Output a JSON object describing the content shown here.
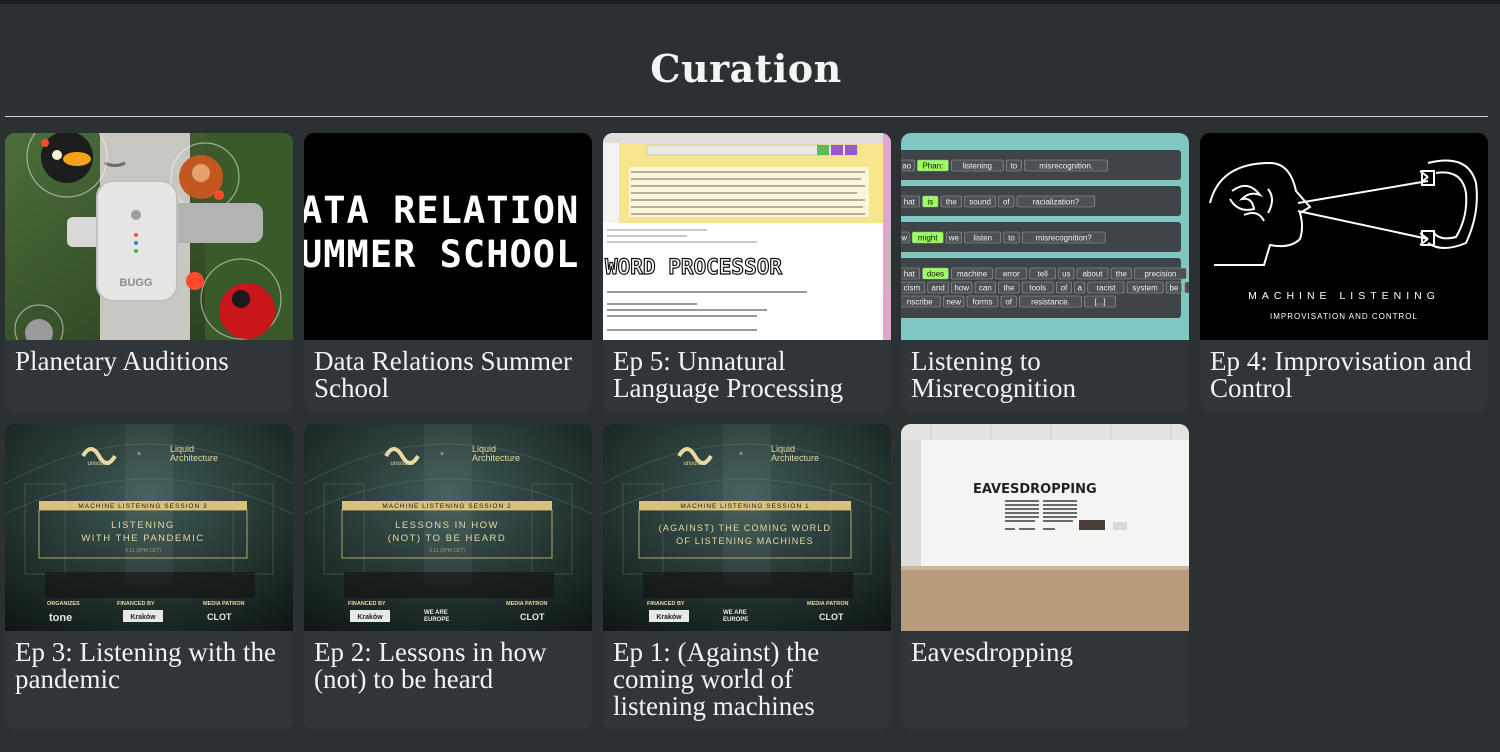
{
  "page": {
    "heading": "Curation"
  },
  "cards": [
    {
      "title": "Planetary Auditions",
      "thumb": {
        "brand": "BUGG"
      }
    },
    {
      "title": "Data Relations Summer School",
      "thumb": {
        "line1": "ATA RELATION",
        "line2": "UMMER SCHOOL"
      }
    },
    {
      "title": "Ep 5: Unnatural Language Processing",
      "thumb": {
        "banner": "WORD PROCESSOR"
      }
    },
    {
      "title": "Listening to Misrecognition",
      "thumb": {
        "rows": [
          [
            "ao",
            "Phan:",
            "listening",
            "to",
            "misrecognition."
          ],
          [
            "hat",
            "is",
            "the",
            "sound",
            "of",
            "racialization?"
          ],
          [
            "w",
            "might",
            "we",
            "listen",
            "to",
            "misrecognition?"
          ],
          [
            "hat",
            "does",
            "machine",
            "error",
            "tell",
            "us",
            "about",
            "the",
            "precision",
            "of"
          ],
          [
            "cism",
            "and",
            "how",
            "can",
            "the",
            "tools",
            "of",
            "a",
            "racist",
            "system",
            "be",
            "used",
            "to"
          ],
          [
            "nscribe",
            "new",
            "forms",
            "of",
            "resistance.",
            "[...]"
          ]
        ]
      }
    },
    {
      "title": "Ep 4: Improvisation and Control",
      "thumb": {
        "line1": "MACHINE LISTENING",
        "line2": "IMPROVISATION AND CONTROL"
      }
    },
    {
      "title": "Ep 3: Listening with the pandemic",
      "thumb": {
        "logo_left": "unsound",
        "logo_right_1": "Liquid",
        "logo_right_2": "Architecture",
        "session": "MACHINE LISTENING SESSION 3",
        "line1": "LISTENING",
        "line2": "WITH THE PANDEMIC",
        "date": "4.11 (3PM CET)",
        "org": "ORGANIZES",
        "fin": "FINANCED BY",
        "media": "MEDIA PATRON",
        "krakow": "Kraków",
        "tone": "tone",
        "clot": "CLOT"
      }
    },
    {
      "title": "Ep 2: Lessons in how (not) to be heard",
      "thumb": {
        "logo_left": "unsound",
        "logo_right_1": "Liquid",
        "logo_right_2": "Architecture",
        "session": "MACHINE LISTENING SESSION 2",
        "line1": "LESSONS IN HOW",
        "line2": "(NOT) TO BE HEARD",
        "date": "3.11 (3PM CET)",
        "fin": "FINANCED BY",
        "media": "MEDIA PATRON",
        "krakow": "Kraków",
        "europe_1": "WE ARE",
        "europe_2": "EUROPE",
        "clot": "CLOT"
      }
    },
    {
      "title": "Ep 1: (Against) the coming world of listening machines",
      "thumb": {
        "logo_left": "unsound",
        "logo_right_1": "Liquid",
        "logo_right_2": "Architecture",
        "session": "MACHINE LISTENING SESSION 1",
        "line1": "(AGAINST) THE COMING WORLD",
        "line2": "OF LISTENING MACHINES",
        "fin": "FINANCED BY",
        "media": "MEDIA PATRON",
        "krakow": "Kraków",
        "europe_1": "WE ARE",
        "europe_2": "EUROPE",
        "clot": "CLOT"
      }
    },
    {
      "title": "Eavesdropping",
      "thumb": {
        "wall_title": "EAVESDROPPING"
      }
    }
  ]
}
